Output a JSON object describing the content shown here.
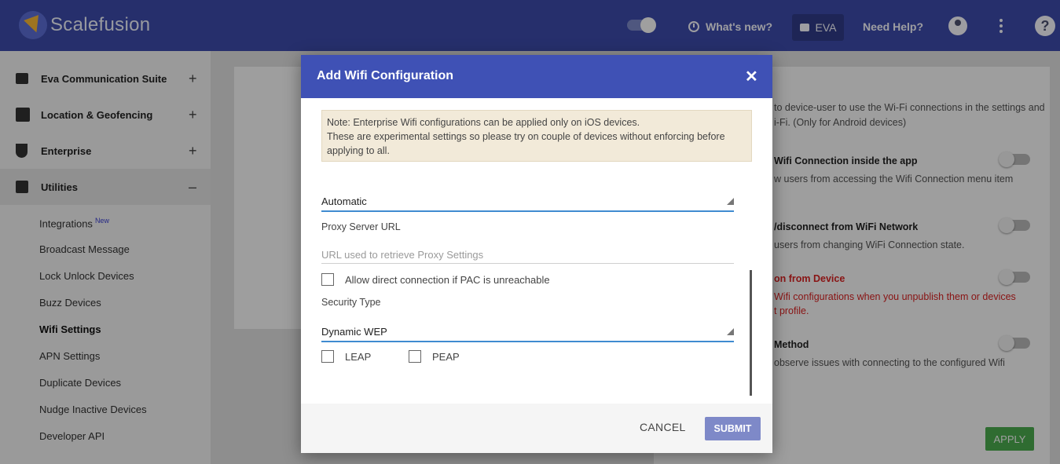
{
  "header": {
    "brand": "Scalefusion",
    "whats_new": "What's new?",
    "eva": "EVA",
    "need_help": "Need Help?"
  },
  "sidebar": {
    "sections": [
      {
        "label": "Eva Communication Suite",
        "toggle": "+"
      },
      {
        "label": "Location & Geofencing",
        "toggle": "+"
      },
      {
        "label": "Enterprise",
        "toggle": "+"
      },
      {
        "label": "Utilities",
        "toggle": "–"
      }
    ],
    "sub_items": [
      {
        "label": "Integrations",
        "badge": "New"
      },
      {
        "label": "Broadcast Message"
      },
      {
        "label": "Lock Unlock Devices"
      },
      {
        "label": "Buzz Devices"
      },
      {
        "label": "Wifi Settings"
      },
      {
        "label": "APN Settings"
      },
      {
        "label": "Duplicate Devices"
      },
      {
        "label": "Nudge Inactive Devices"
      },
      {
        "label": "Developer API"
      }
    ]
  },
  "background_panel": {
    "desc_1": "to device-user to use the Wi-Fi connections in the settings and",
    "desc_2": "i-Fi. (Only for Android devices)",
    "opt1_title": "Wifi Connection inside the app",
    "opt1_desc": "w users from accessing the Wifi Connection menu item",
    "opt2_title": "/disconnect from WiFi Network",
    "opt2_desc": "users from changing WiFi Connection state.",
    "opt3_title": "on from Device",
    "opt3_desc_1": "Wifi configurations when you unpublish them or devices",
    "opt3_desc_2": "t profile.",
    "opt4_title": "Method",
    "opt4_desc": "observe issues with connecting to the configured Wifi",
    "apply": "APPLY"
  },
  "modal": {
    "title": "Add Wifi Configuration",
    "note_line1": "Note: Enterprise Wifi configurations can be applied only on iOS devices.",
    "note_line2": "These are experimental settings so please try on couple of devices without enforcing before applying to all.",
    "proxy_select_value": "Automatic",
    "proxy_url_label": "Proxy Server URL",
    "proxy_url_placeholder": "URL used to retrieve Proxy Settings",
    "allow_direct_label": "Allow direct connection if PAC is unreachable",
    "security_type_label": "Security Type",
    "security_type_value": "Dynamic WEP",
    "leap_label": "LEAP",
    "peap_label": "PEAP",
    "cancel": "CANCEL",
    "submit": "SUBMIT"
  },
  "colors": {
    "header": "#3f51b5",
    "submit": "#7e89c8",
    "apply": "#4caf50",
    "select_underline": "#3f8bd0"
  }
}
